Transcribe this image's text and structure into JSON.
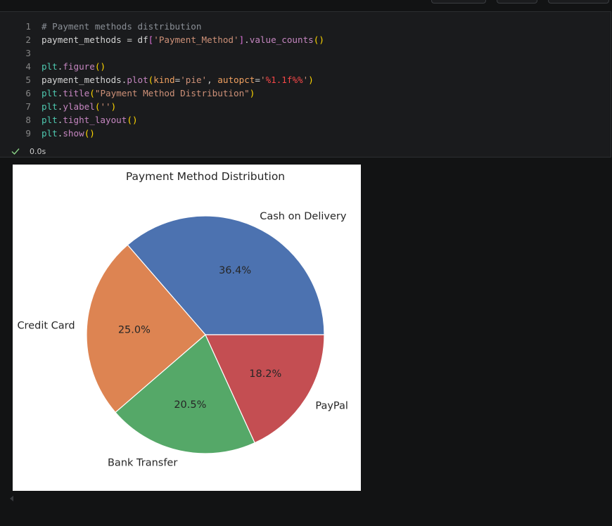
{
  "cell": {
    "lines": [
      {
        "n": "1",
        "text": "# Payment methods distribution"
      },
      {
        "n": "2",
        "text": "payment_methods = df['Payment_Method'].value_counts()"
      },
      {
        "n": "3",
        "text": ""
      },
      {
        "n": "4",
        "text": "plt.figure()"
      },
      {
        "n": "5",
        "text": "payment_methods.plot(kind='pie', autopct='%1.1f%%')"
      },
      {
        "n": "6",
        "text": "plt.title(\"Payment Method Distribution\")"
      },
      {
        "n": "7",
        "text": "plt.ylabel('')"
      },
      {
        "n": "8",
        "text": "plt.tight_layout()"
      },
      {
        "n": "9",
        "text": "plt.show()"
      }
    ],
    "status": {
      "time": "0.0s",
      "icon": "check-icon",
      "icon_color": "#89d185"
    }
  },
  "chart_data": {
    "type": "pie",
    "title": "Payment Method Distribution",
    "slices": [
      {
        "label": "Cash on Delivery",
        "value": 36.4,
        "pct_label": "36.4%",
        "color": "#4c72b0"
      },
      {
        "label": "Credit Card",
        "value": 25.0,
        "pct_label": "25.0%",
        "color": "#dd8452"
      },
      {
        "label": "Bank Transfer",
        "value": 20.5,
        "pct_label": "20.5%",
        "color": "#55a868"
      },
      {
        "label": "PayPal",
        "value": 18.2,
        "pct_label": "18.2%",
        "color": "#c44e52"
      }
    ],
    "start_angle": 0,
    "direction": "counterclockwise",
    "legend": "none"
  }
}
